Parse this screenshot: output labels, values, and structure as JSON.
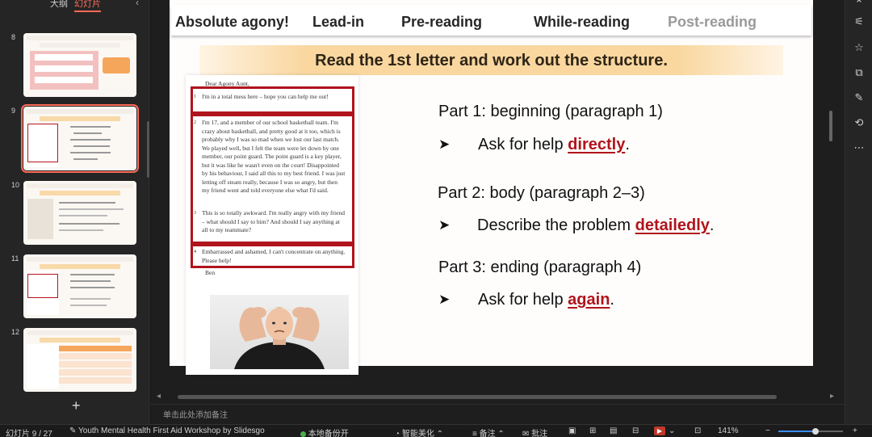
{
  "left_panel": {
    "tabs": [
      {
        "label": "大纲",
        "active": false
      },
      {
        "label": "幻灯片",
        "active": true
      }
    ],
    "thumbnails": [
      {
        "number": "8",
        "selected": false
      },
      {
        "number": "9",
        "selected": true
      },
      {
        "number": "10",
        "selected": false
      },
      {
        "number": "11",
        "selected": false
      },
      {
        "number": "12",
        "selected": false
      }
    ],
    "add_label": "+"
  },
  "slide": {
    "nav": [
      {
        "label": "Absolute agony!",
        "dim": false
      },
      {
        "label": "Lead-in",
        "dim": false
      },
      {
        "label": "Pre-reading",
        "dim": false
      },
      {
        "label": "While-reading",
        "dim": false
      },
      {
        "label": "Post-reading",
        "dim": true
      }
    ],
    "title": "Read the 1st letter and work out the structure.",
    "letter": {
      "greeting": "Dear Agony Aunt,",
      "p1_num": "1",
      "p1": "I'm in a total mess here – hope you can help me out!",
      "p2_num": "2",
      "p2": "I'm 17, and a member of our school basketball team. I'm crazy about basketball, and pretty good at it too, which is probably why I was so mad when we lost our last match. We played well, but I felt the team were let down by one member, our point guard. The point guard is a key player, but it was like he wasn't even on the court! Disappointed by his behaviour, I said all this to my best friend. I was just letting off steam really, because I was so angry, but then my friend went and told everyone else what I'd said.",
      "p3_num": "3",
      "p3": "This is so totally awkward. I'm really angry with my friend – what should I say to him? And should I say anything at all to my teammate?",
      "p4_num": "4",
      "p4": "Embarrassed and ashamed, I can't concentrate on anything. Please help!",
      "signature": "Ben"
    },
    "parts": [
      {
        "title": "Part 1: beginning (paragraph 1)",
        "arrow": "➤",
        "desc_prefix": "Ask for help ",
        "keyword": "directly",
        "desc_suffix": "."
      },
      {
        "title": "Part 2: body (paragraph 2–3)",
        "arrow": "➤",
        "desc_prefix": "Describe the problem ",
        "keyword": "detailedly",
        "desc_suffix": "."
      },
      {
        "title": "Part 3: ending (paragraph 4)",
        "arrow": "➤",
        "desc_prefix": "Ask for help ",
        "keyword": "again",
        "desc_suffix": "."
      }
    ]
  },
  "notes_placeholder": "单击此处添加备注",
  "status_bar": {
    "slide_counter": "幻灯片 9 / 27",
    "theme": "Youth Mental Health First Aid Workshop by Slidesgo",
    "backup": "本地备份开",
    "beautify": "智能美化",
    "notes": "备注",
    "comments": "批注",
    "zoom": "141%"
  },
  "colors": {
    "accent": "#ff6b57",
    "keyword_red": "#b0141c",
    "banner": "#f9d79f"
  }
}
